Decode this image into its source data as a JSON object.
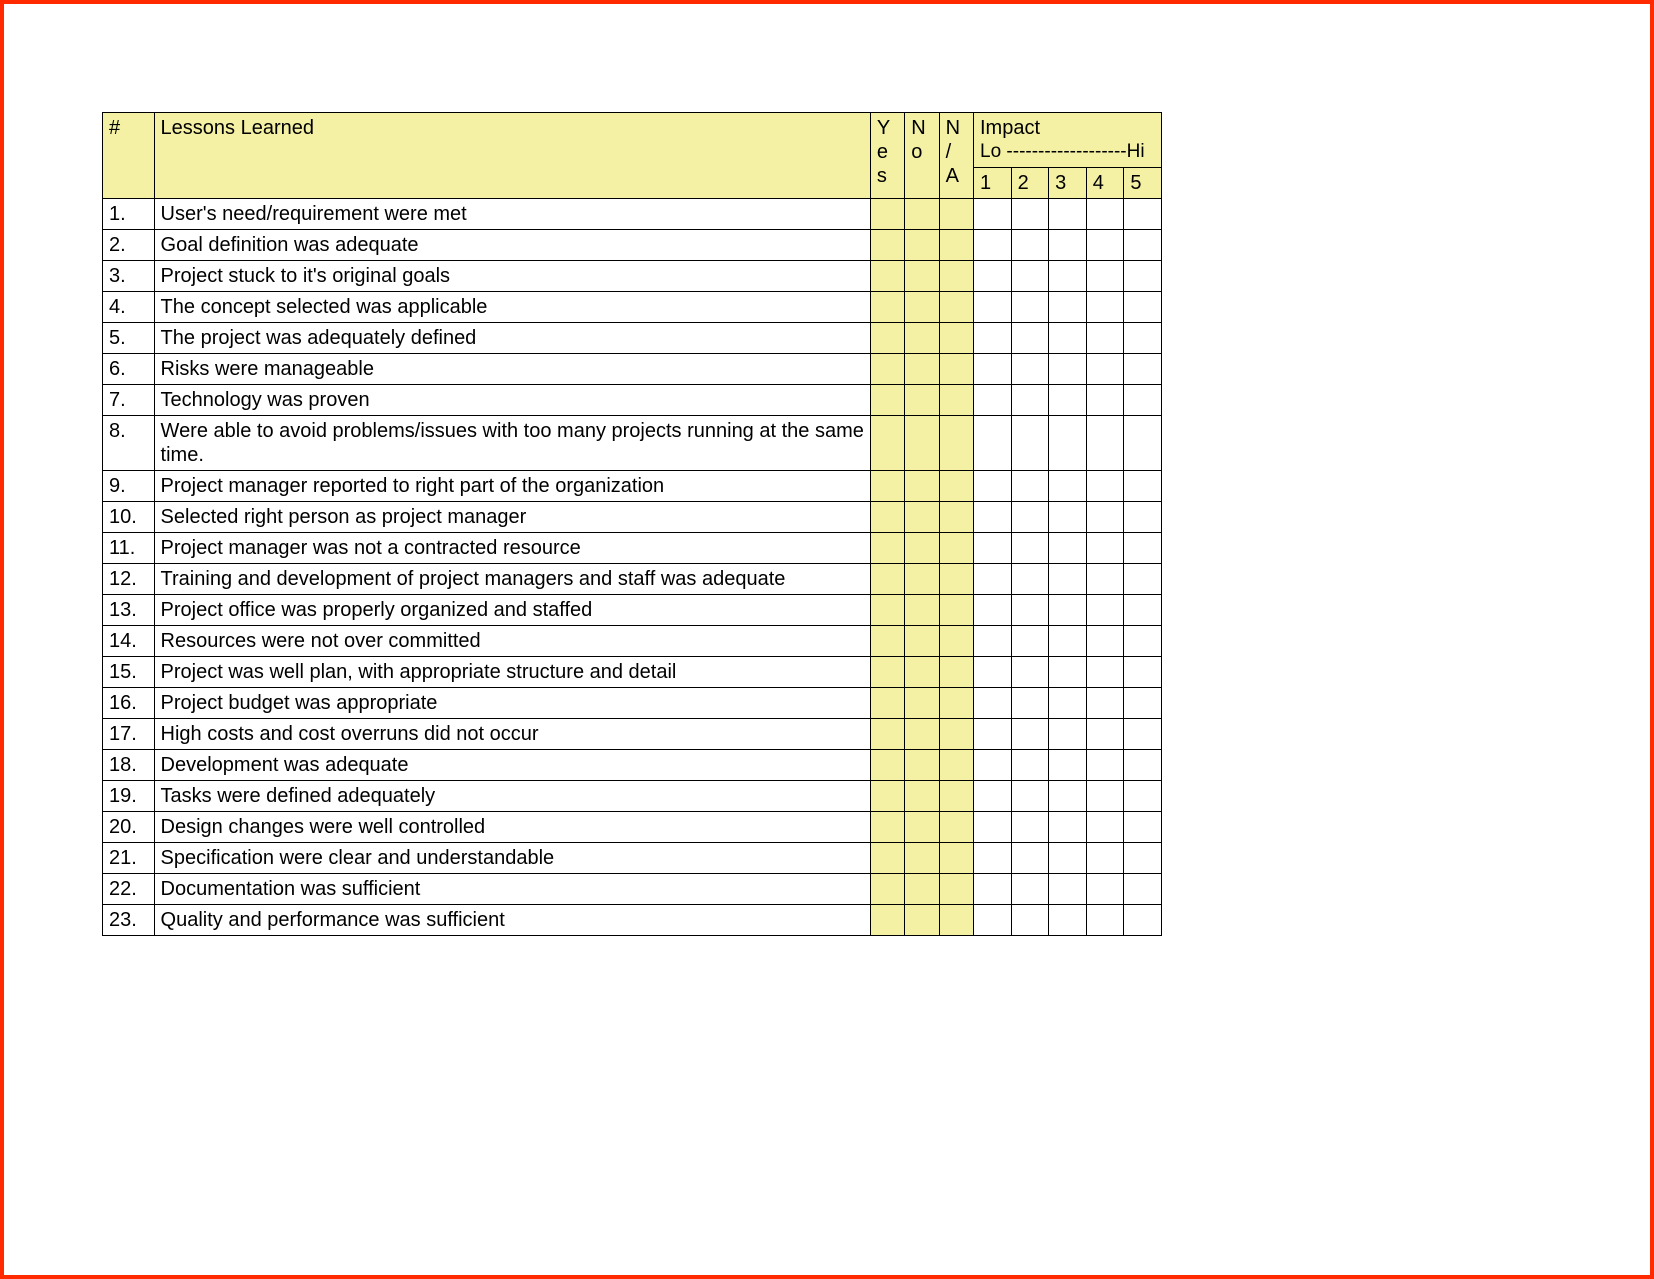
{
  "header": {
    "num": "#",
    "title": "Lessons Learned",
    "yes": "Y\ne\ns",
    "no": "N\no",
    "na": "N\n/\nA",
    "impact_title": "Impact",
    "impact_range": "Lo -------------------Hi",
    "impact_cols": [
      "1",
      "2",
      "3",
      "4",
      "5"
    ]
  },
  "rows": [
    {
      "n": "1.",
      "text": "User's need/requirement were met"
    },
    {
      "n": "2.",
      "text": "Goal definition was adequate"
    },
    {
      "n": "3.",
      "text": "Project stuck to it's original goals"
    },
    {
      "n": "4.",
      "text": "The concept selected was applicable"
    },
    {
      "n": "5.",
      "text": "The project was adequately defined"
    },
    {
      "n": "6.",
      "text": "Risks were manageable"
    },
    {
      "n": "7.",
      "text": "Technology was proven"
    },
    {
      "n": "8.",
      "text": "Were able to avoid problems/issues with too many projects running at the same time."
    },
    {
      "n": "9.",
      "text": "Project manager reported to right part of the organization"
    },
    {
      "n": "10.",
      "text": "Selected right person as project manager"
    },
    {
      "n": "11.",
      "text": "Project manager was not a contracted resource"
    },
    {
      "n": "12.",
      "text": "Training and development of project managers and staff was adequate"
    },
    {
      "n": "13.",
      "text": "Project office was properly organized and staffed"
    },
    {
      "n": "14.",
      "text": "Resources were not over committed"
    },
    {
      "n": "15.",
      "text": "Project was well plan, with appropriate structure and detail"
    },
    {
      "n": "16.",
      "text": "Project budget was appropriate"
    },
    {
      "n": "17.",
      "text": "High costs and cost overruns did not occur"
    },
    {
      "n": "18.",
      "text": "Development was adequate"
    },
    {
      "n": "19.",
      "text": "Tasks were defined adequately"
    },
    {
      "n": "20.",
      "text": "Design changes were well controlled"
    },
    {
      "n": "21.",
      "text": "Specification were clear and understandable"
    },
    {
      "n": "22.",
      "text": "Documentation was sufficient"
    },
    {
      "n": "23.",
      "text": "Quality and performance was sufficient"
    }
  ]
}
